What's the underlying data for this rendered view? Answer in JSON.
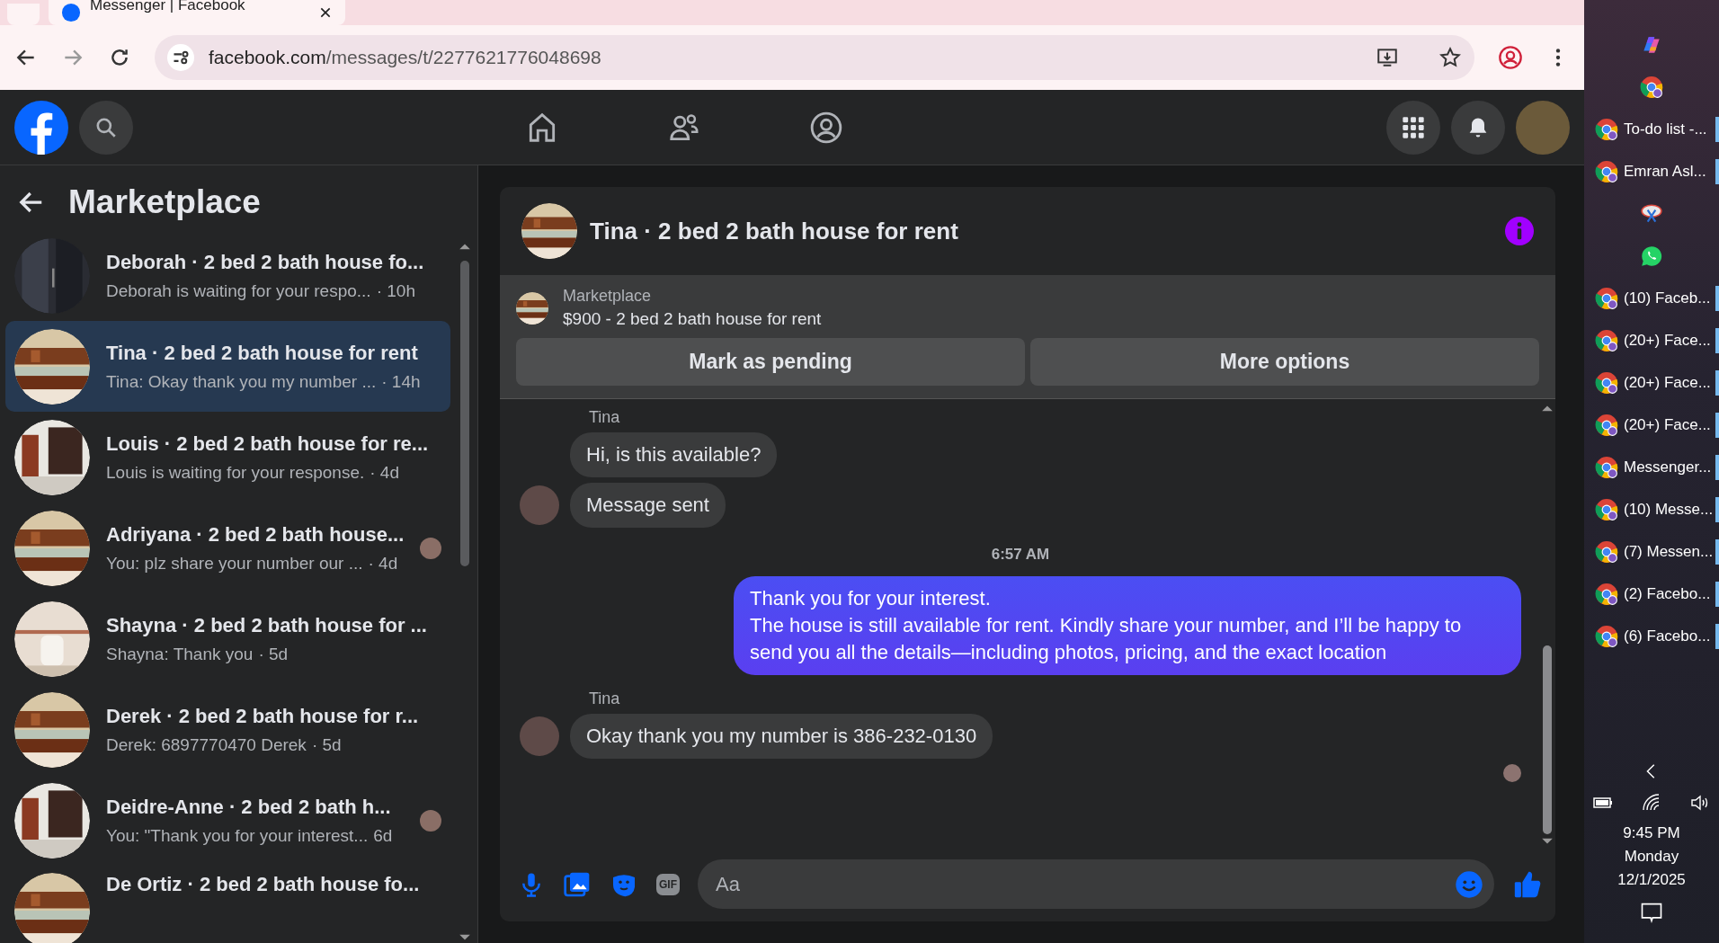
{
  "browser": {
    "tab_title": "Messenger | Facebook",
    "url_domain": "facebook.com",
    "url_path": "/messages/t/2277621776048698"
  },
  "sidebar": {
    "title": "Marketplace",
    "conversations": [
      {
        "title": "Deborah · 2 bed 2 bath house fo...",
        "preview": "Deborah is waiting for your respo...",
        "time": "· 10h",
        "selected": false,
        "seen_avatar": false
      },
      {
        "title": "Tina · 2 bed 2 bath house for rent",
        "preview": "Tina: Okay thank you my number ...",
        "time": "· 14h",
        "selected": true,
        "seen_avatar": false
      },
      {
        "title": "Louis · 2 bed 2 bath house for re...",
        "preview": "Louis is waiting for your response.",
        "time": "· 4d",
        "selected": false,
        "seen_avatar": false
      },
      {
        "title": "Adriyana · 2 bed 2 bath house...",
        "preview": "You: plz share your number our ...",
        "time": "· 4d",
        "selected": false,
        "seen_avatar": true
      },
      {
        "title": "Shayna · 2 bed 2 bath house for ...",
        "preview": "Shayna: Thank you",
        "time": "· 5d",
        "selected": false,
        "seen_avatar": false
      },
      {
        "title": "Derek · 2 bed 2 bath house for r...",
        "preview": "Derek: 6897770470 Derek",
        "time": "· 5d",
        "selected": false,
        "seen_avatar": false
      },
      {
        "title": "Deidre-Anne · 2 bed 2 bath h...",
        "preview": "You: \"Thank you for your interest...",
        "time": "6d",
        "selected": false,
        "seen_avatar": true
      },
      {
        "title": "De Ortiz · 2 bed 2 bath house fo..."
      }
    ]
  },
  "chat": {
    "title": "Tina · 2 bed 2 bath house for rent",
    "listing": {
      "label": "Marketplace",
      "name": "$900 - 2 bed 2 bath house for rent"
    },
    "buttons": [
      "Mark as pending",
      "More options"
    ],
    "messages": [
      {
        "kind": "sender",
        "text": "Tina"
      },
      {
        "kind": "incoming",
        "text": "Hi, is this available?",
        "avatar": false
      },
      {
        "kind": "incoming",
        "text": "Message sent",
        "avatar": true
      },
      {
        "kind": "time",
        "text": "6:57 AM"
      },
      {
        "kind": "outgoing",
        "lines": [
          "Thank you for your interest.",
          "The house is still available for rent. Kindly share your number, and I’ll be happy to send you all the details—including photos, pricing, and the exact location"
        ]
      },
      {
        "kind": "sender",
        "text": "Tina"
      },
      {
        "kind": "incoming",
        "text": "Okay thank you my number is 386-232-0130",
        "avatar": true
      },
      {
        "kind": "seen"
      }
    ],
    "composer": {
      "placeholder": "Aa",
      "gif_label": "GIF"
    }
  },
  "taskbar": {
    "items": [
      {
        "kind": "copilot"
      },
      {
        "kind": "chrome"
      },
      {
        "kind": "window",
        "label": "To-do list -..."
      },
      {
        "kind": "window",
        "label": "Emran Asl..."
      },
      {
        "kind": "snip"
      },
      {
        "kind": "whatsapp"
      },
      {
        "kind": "window",
        "label": "(10) Faceb..."
      },
      {
        "kind": "window",
        "label": "(20+) Face..."
      },
      {
        "kind": "window",
        "label": "(20+) Face..."
      },
      {
        "kind": "window",
        "label": "(20+) Face..."
      },
      {
        "kind": "window",
        "label": "Messenger..."
      },
      {
        "kind": "window",
        "label": "(10) Messe..."
      },
      {
        "kind": "window",
        "label": "(7) Messen..."
      },
      {
        "kind": "window",
        "label": "(2) Facebo..."
      },
      {
        "kind": "window",
        "label": "(6) Facebo..."
      }
    ],
    "clock": {
      "time": "9:45 PM",
      "day": "Monday",
      "date": "12/1/2025"
    }
  }
}
